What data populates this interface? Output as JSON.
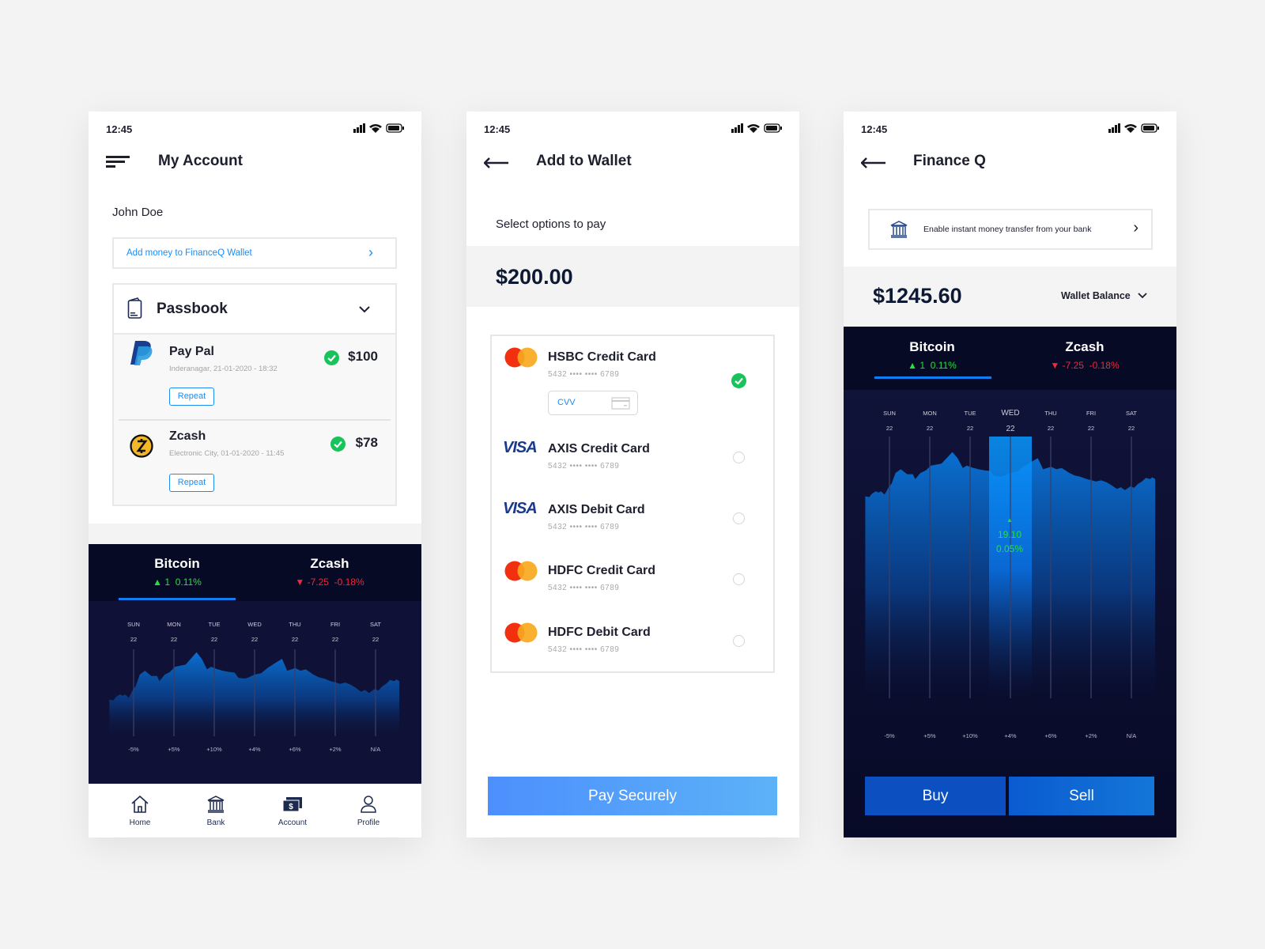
{
  "status_bar": {
    "time": "12:45"
  },
  "screen1": {
    "title": "My Account",
    "menu_icon": "hamburger-icon",
    "user_name": "John Doe",
    "add_money_link": "Add money to FinanceQ Wallet",
    "passbook": {
      "title": "Passbook",
      "items": [
        {
          "name": "Pay Pal",
          "detail": "Inderanagar, 21-01-2020 - 18:32",
          "amount": "$100",
          "action": "Repeat",
          "icon": "paypal-logo"
        },
        {
          "name": "Zcash",
          "detail": "Electronic City, 01-01-2020 - 11:45",
          "amount": "$78",
          "action": "Repeat",
          "icon": "zcash-logo"
        }
      ]
    },
    "nav": [
      {
        "label": "Home",
        "icon": "home-icon"
      },
      {
        "label": "Bank",
        "icon": "bank-icon"
      },
      {
        "label": "Account",
        "icon": "money-icon"
      },
      {
        "label": "Profile",
        "icon": "user-icon"
      }
    ]
  },
  "screen2": {
    "title": "Add to Wallet",
    "subtitle": "Select options to pay",
    "amount": "$200.00",
    "cvv_placeholder": "CVV",
    "cards": [
      {
        "name": "HSBC Credit Card",
        "number": "5432 •••• •••• 6789",
        "brand": "mastercard",
        "selected": true
      },
      {
        "name": "AXIS Credit Card",
        "number": "5432 •••• •••• 6789",
        "brand": "visa",
        "selected": false
      },
      {
        "name": "AXIS Debit Card",
        "number": "5432 •••• •••• 6789",
        "brand": "visa",
        "selected": false
      },
      {
        "name": "HDFC Credit Card",
        "number": "5432 •••• •••• 6789",
        "brand": "mastercard",
        "selected": false
      },
      {
        "name": "HDFC Debit Card",
        "number": "5432 •••• •••• 6789",
        "brand": "mastercard",
        "selected": false
      }
    ],
    "visa_label": "VISA",
    "pay_button": "Pay Securely"
  },
  "screen3": {
    "title": "Finance Q",
    "bank_banner": "Enable instant money transfer from your bank",
    "balance": "$1245.60",
    "balance_selector": "Wallet Balance",
    "highlight": {
      "day": "WED",
      "value": "19.10",
      "percent": "0.05%"
    },
    "buy_button": "Buy",
    "sell_button": "Sell"
  },
  "tabs": [
    {
      "name": "Bitcoin",
      "change": "1",
      "percent": "0.11%",
      "direction": "up",
      "active": true
    },
    {
      "name": "Zcash",
      "change": "-7.25",
      "percent": "-0.18%",
      "direction": "down",
      "active": false
    }
  ],
  "colors": {
    "accent": "#0f7ef0",
    "up": "#27e03c",
    "down": "#f0283c",
    "dark_bg": "#070a24",
    "success": "#17c35a"
  },
  "chart_data": {
    "type": "area",
    "days": [
      "SUN",
      "MON",
      "TUE",
      "WED",
      "THU",
      "FRI",
      "SAT"
    ],
    "dates": [
      "22",
      "22",
      "22",
      "22",
      "22",
      "22",
      "22"
    ],
    "changes": [
      "-5%",
      "+5%",
      "+10%",
      "+4%",
      "+6%",
      "+2%",
      "N/A"
    ],
    "points": [
      [
        -0.6,
        130
      ],
      [
        -0.5,
        127
      ],
      [
        -0.44,
        140
      ],
      [
        -0.34,
        150
      ],
      [
        -0.27,
        145
      ],
      [
        -0.21,
        150
      ],
      [
        -0.12,
        137
      ],
      [
        -0.01,
        170
      ],
      [
        0.05,
        180
      ],
      [
        0.15,
        225
      ],
      [
        0.28,
        240
      ],
      [
        0.44,
        220
      ],
      [
        0.58,
        220
      ],
      [
        0.64,
        200
      ],
      [
        0.77,
        225
      ],
      [
        0.9,
        235
      ],
      [
        1.03,
        255
      ],
      [
        1.29,
        263
      ],
      [
        1.56,
        310
      ],
      [
        1.69,
        285
      ],
      [
        1.82,
        245
      ],
      [
        1.92,
        255
      ],
      [
        2.05,
        247
      ],
      [
        2.21,
        240
      ],
      [
        2.37,
        235
      ],
      [
        2.5,
        233
      ],
      [
        2.6,
        213
      ],
      [
        2.76,
        210
      ],
      [
        2.86,
        215
      ],
      [
        2.99,
        225
      ],
      [
        3.16,
        230
      ],
      [
        3.32,
        250
      ],
      [
        3.52,
        270
      ],
      [
        3.68,
        285
      ],
      [
        3.81,
        240
      ],
      [
        4.01,
        250
      ],
      [
        4.14,
        240
      ],
      [
        4.27,
        245
      ],
      [
        4.46,
        225
      ],
      [
        4.59,
        215
      ],
      [
        4.73,
        210
      ],
      [
        4.89,
        200
      ],
      [
        5.02,
        195
      ],
      [
        5.12,
        190
      ],
      [
        5.25,
        195
      ],
      [
        5.38,
        187
      ],
      [
        5.51,
        175
      ],
      [
        5.64,
        160
      ],
      [
        5.74,
        167
      ],
      [
        5.84,
        155
      ],
      [
        5.97,
        170
      ],
      [
        6.07,
        165
      ],
      [
        6.16,
        180
      ],
      [
        6.26,
        190
      ],
      [
        6.36,
        205
      ],
      [
        6.46,
        200
      ],
      [
        6.52,
        207
      ],
      [
        6.59,
        200
      ]
    ],
    "grid": true
  }
}
